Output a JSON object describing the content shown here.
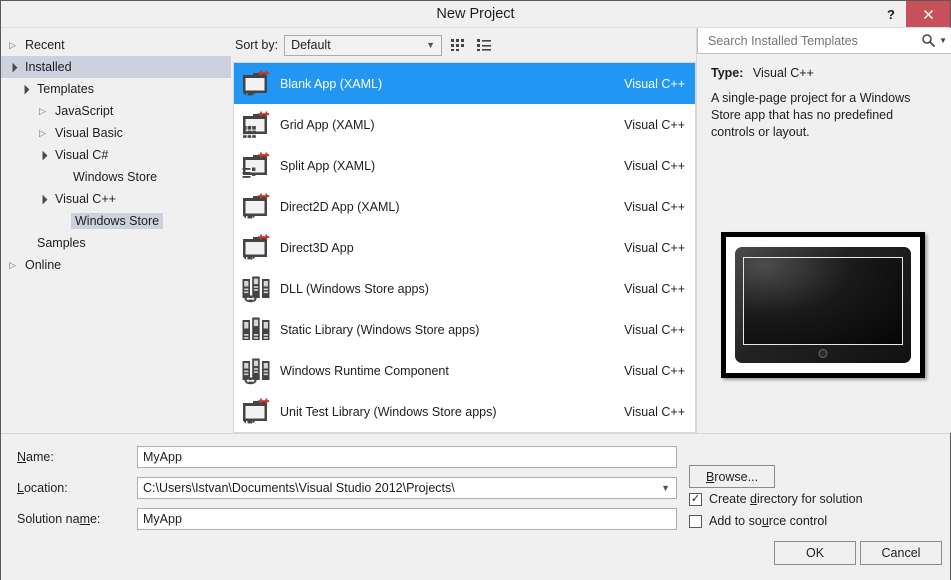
{
  "window": {
    "title": "New Project",
    "help_label": "?",
    "close_icon": "close-icon"
  },
  "tree": {
    "nodes": [
      {
        "label": "Recent",
        "indent": 0,
        "state": "collapsed",
        "selected": false
      },
      {
        "label": "Installed",
        "indent": 0,
        "state": "expanded",
        "selected": true
      },
      {
        "label": "Templates",
        "indent": 1,
        "state": "expanded",
        "selected": false
      },
      {
        "label": "JavaScript",
        "indent": 2,
        "state": "collapsed",
        "selected": false
      },
      {
        "label": "Visual Basic",
        "indent": 2,
        "state": "collapsed",
        "selected": false
      },
      {
        "label": "Visual C#",
        "indent": 2,
        "state": "expanded",
        "selected": false
      },
      {
        "label": "Windows Store",
        "indent": 3,
        "state": "none",
        "selected": false
      },
      {
        "label": "Visual C++",
        "indent": 2,
        "state": "expanded",
        "selected": false
      },
      {
        "label": "Windows Store",
        "indent": 3,
        "state": "none",
        "selected": true
      },
      {
        "label": "Samples",
        "indent": 1,
        "state": "none",
        "selected": false
      },
      {
        "label": "Online",
        "indent": 0,
        "state": "collapsed",
        "selected": false
      }
    ]
  },
  "sortbar": {
    "label": "Sort by:",
    "selected_option": "Default",
    "options": [
      "Default"
    ],
    "tiles_view_icon": "tiles-view-icon",
    "list_view_icon": "list-view-icon"
  },
  "templates": {
    "items": [
      {
        "name": "Blank App (XAML)",
        "language": "Visual C++",
        "icon": "window-plusplus-icon",
        "selected": true
      },
      {
        "name": "Grid App (XAML)",
        "language": "Visual C++",
        "icon": "grid-app-icon",
        "selected": false
      },
      {
        "name": "Split App (XAML)",
        "language": "Visual C++",
        "icon": "split-app-icon",
        "selected": false
      },
      {
        "name": "Direct2D App (XAML)",
        "language": "Visual C++",
        "icon": "window-plusplus-icon",
        "selected": false
      },
      {
        "name": "Direct3D App",
        "language": "Visual C++",
        "icon": "window-plusplus-icon",
        "selected": false
      },
      {
        "name": "DLL (Windows Store apps)",
        "language": "Visual C++",
        "icon": "dll-library-icon",
        "selected": false
      },
      {
        "name": "Static Library (Windows Store apps)",
        "language": "Visual C++",
        "icon": "static-library-icon",
        "selected": false
      },
      {
        "name": "Windows Runtime Component",
        "language": "Visual C++",
        "icon": "dll-library-icon",
        "selected": false
      },
      {
        "name": "Unit Test Library (Windows Store apps)",
        "language": "Visual C++",
        "icon": "window-plusplus-icon",
        "selected": false
      }
    ]
  },
  "search": {
    "placeholder": "Search Installed Templates",
    "value": "",
    "icon": "search-icon",
    "dropdown_icon": "chevron-down-icon"
  },
  "details": {
    "type_label": "Type:",
    "type_value": "Visual C++",
    "description": "A single-page project for a Windows Store app that has no predefined controls or layout.",
    "preview_icon": "tablet-device-preview"
  },
  "form": {
    "name_label": "Name:",
    "name_value": "MyApp",
    "location_label": "Location:",
    "location_value": "C:\\Users\\Istvan\\Documents\\Visual Studio 2012\\Projects\\",
    "solution_label": "Solution name:",
    "solution_value": "MyApp",
    "browse_label": "Browse...",
    "create_directory_label": "Create directory for solution",
    "create_directory_checked": true,
    "add_source_control_label": "Add to source control",
    "add_source_control_checked": false,
    "ok_label": "OK",
    "cancel_label": "Cancel"
  },
  "colors": {
    "accent": "#2196f3",
    "close_button": "#c7515a",
    "tree_selection": "#cdd1dd",
    "icon_dark": "#444444",
    "icon_red": "#c0392b"
  }
}
